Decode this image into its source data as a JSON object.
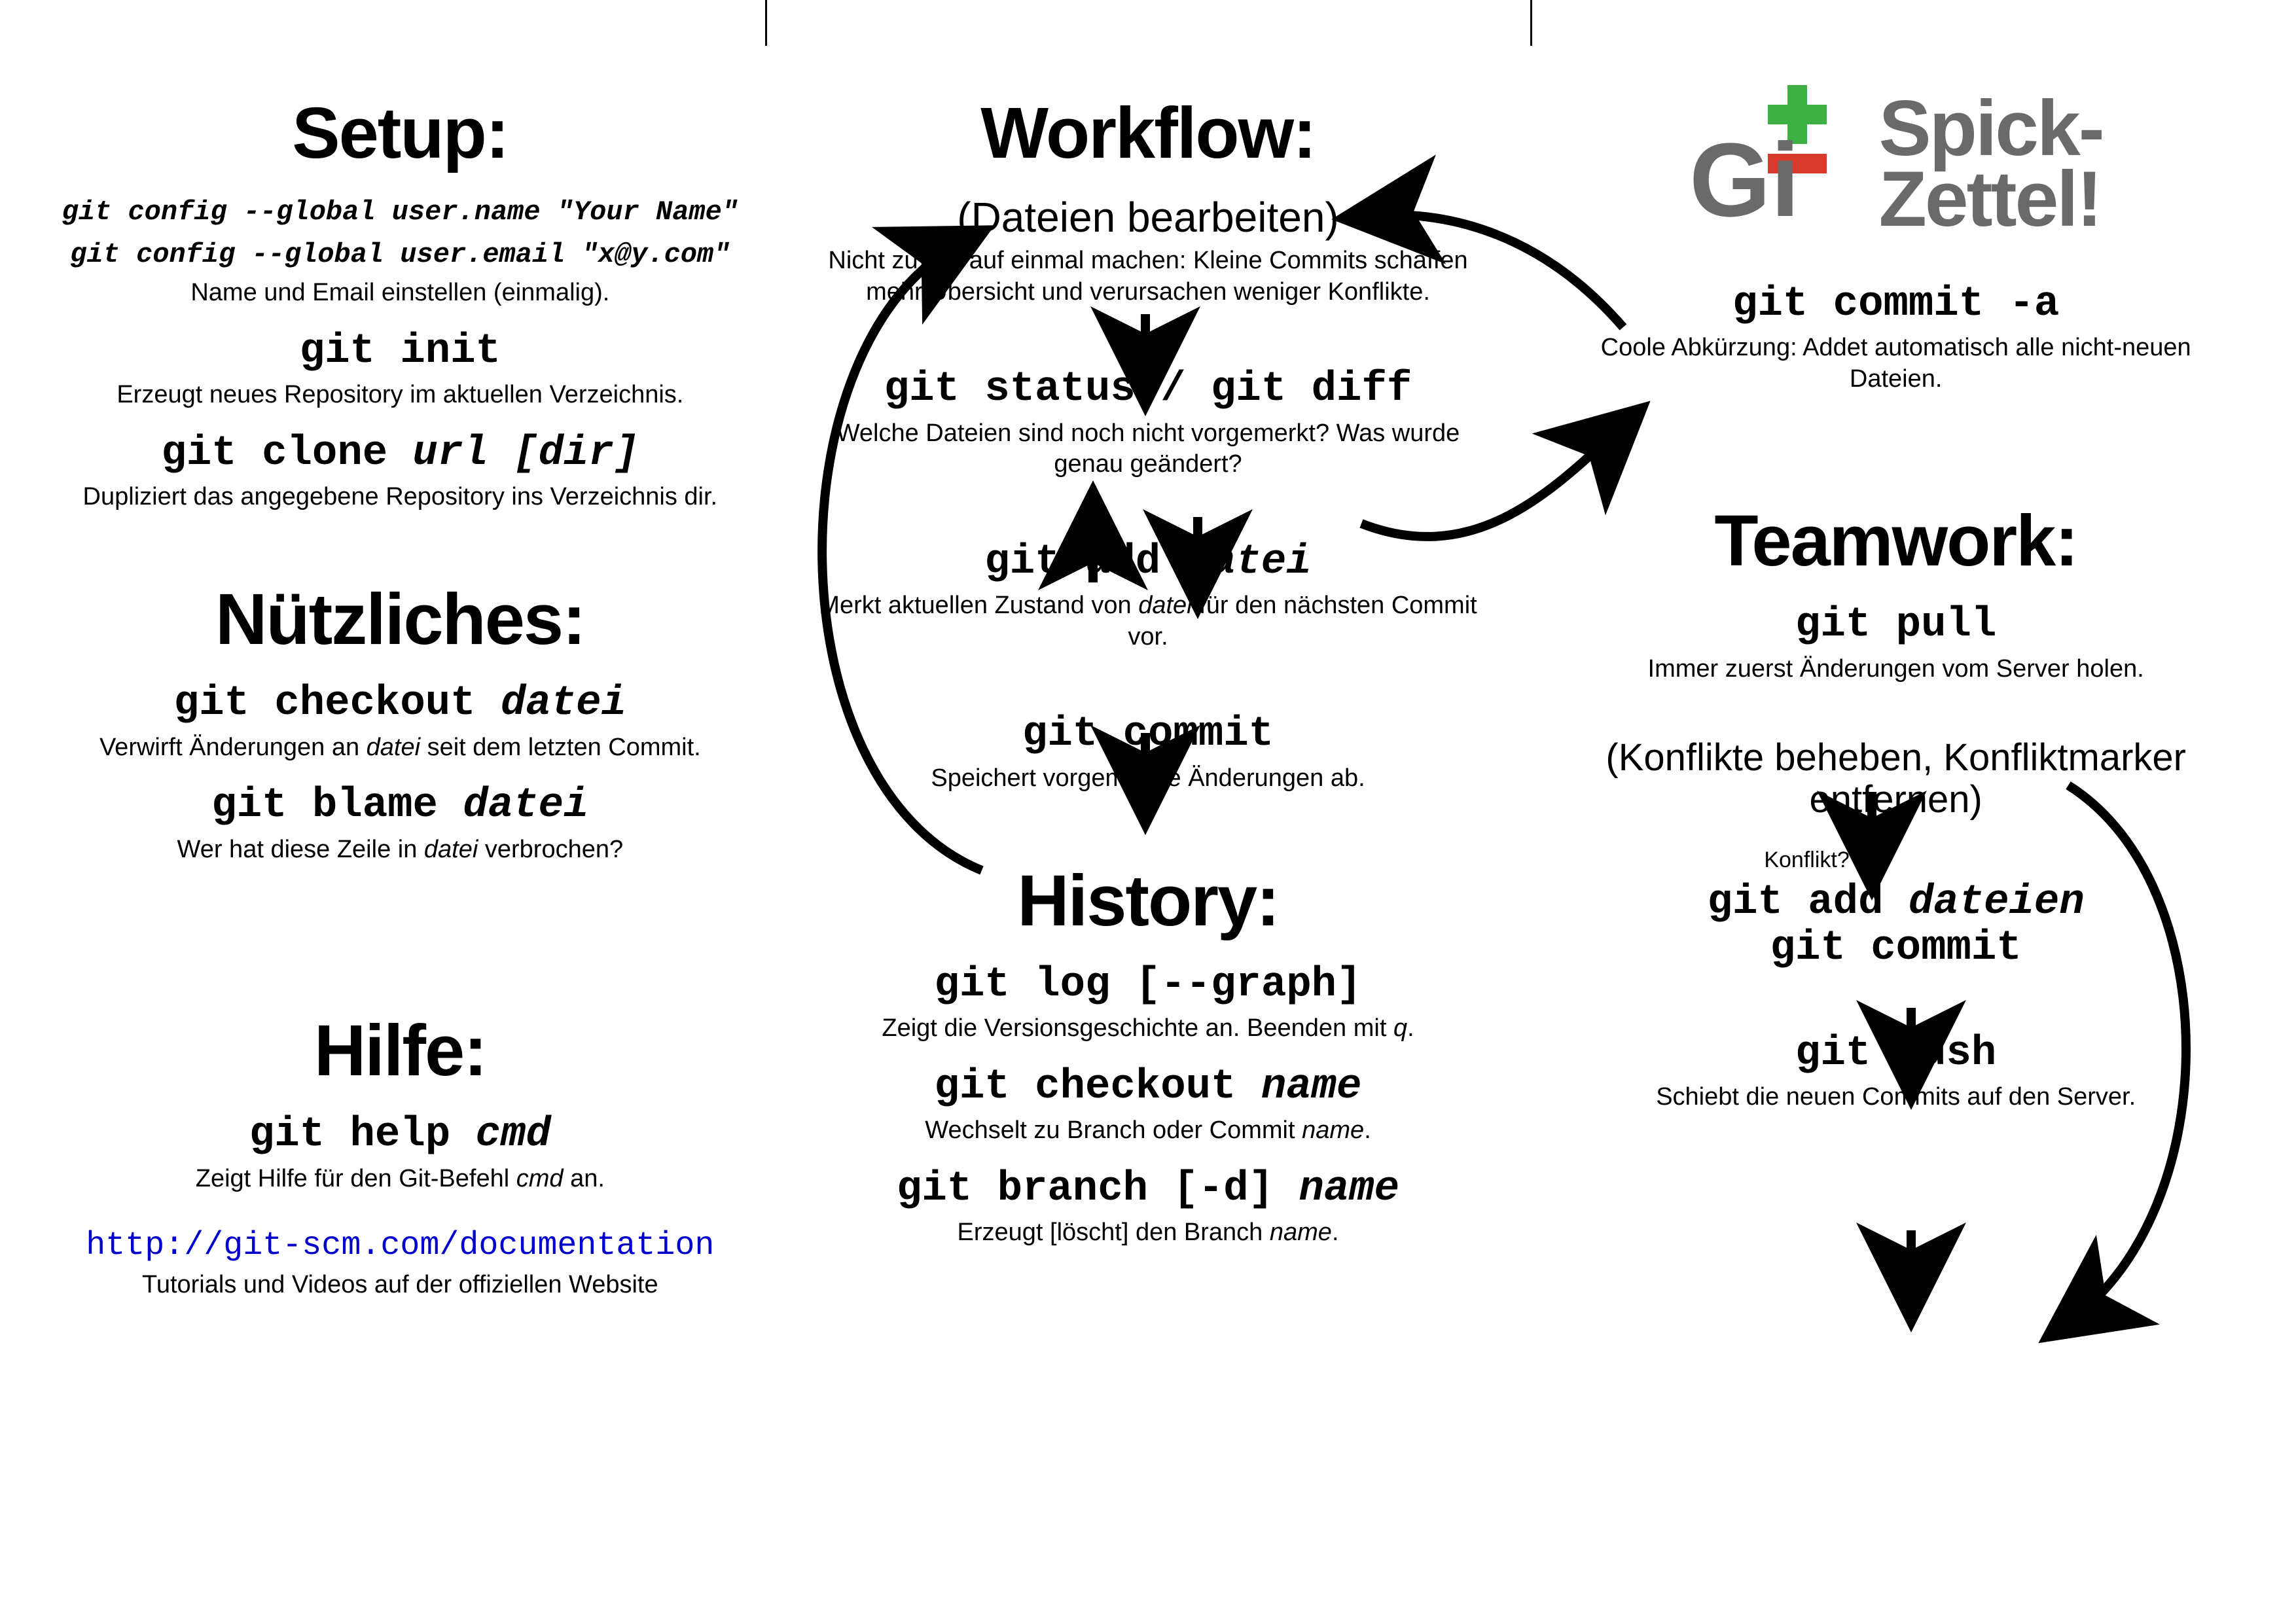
{
  "logo": {
    "line1": "Spick-",
    "line2": "Zettel!"
  },
  "setup": {
    "heading": "Setup:",
    "config_name": "git config --global user.name \"Your Name\"",
    "config_email": "git config --global user.email \"x@y.com\"",
    "config_desc": "Name und Email einstellen (einmalig).",
    "init_cmd": "git init",
    "init_desc": "Erzeugt neues Repository im aktuellen Verzeichnis.",
    "clone_cmd_a": "git clone ",
    "clone_cmd_b": "url [dir]",
    "clone_desc": "Dupliziert das angegebene Repository ins Verzeichnis dir."
  },
  "useful": {
    "heading": "Nützliches:",
    "checkout_a": "git checkout ",
    "checkout_b": "datei",
    "checkout_desc_a": "Verwirft Änderungen an ",
    "checkout_desc_b": "datei",
    "checkout_desc_c": " seit dem letzten Commit.",
    "blame_a": "git blame ",
    "blame_b": "datei",
    "blame_desc_a": "Wer hat diese Zeile in ",
    "blame_desc_b": "datei",
    "blame_desc_c": " verbrochen?"
  },
  "help": {
    "heading": "Hilfe:",
    "help_a": "git help ",
    "help_b": "cmd",
    "help_desc_a": "Zeigt Hilfe für den Git-Befehl ",
    "help_desc_b": "cmd",
    "help_desc_c": " an.",
    "link": "http://git-scm.com/documentation",
    "link_desc": "Tutorials und Videos auf der offiziellen Website"
  },
  "workflow": {
    "heading": "Workflow:",
    "edit": "(Dateien bearbeiten)",
    "edit_desc": "Nicht zu viel auf einmal machen: Kleine Commits schaffen mehr Übersicht und verursachen weniger Konflikte.",
    "status_cmd": "git status / git diff",
    "status_desc": "Welche Dateien sind noch nicht vorgemerkt? Was wurde genau geändert?",
    "add_a": "git add ",
    "add_b": "datei",
    "add_desc_a": "Merkt aktuellen Zustand von ",
    "add_desc_b": "datei",
    "add_desc_c": " für den nächsten Commit vor.",
    "commit_cmd": "git commit",
    "commit_desc": "Speichert vorgemerkte Änderungen ab."
  },
  "history": {
    "heading": "History:",
    "log_cmd": "git log [--graph]",
    "log_desc_a": "Zeigt die Versionsgeschichte an. Beenden mit ",
    "log_desc_b": "q",
    "log_desc_c": ".",
    "checkout_a": "git checkout ",
    "checkout_b": "name",
    "checkout_desc_a": "Wechselt zu Branch oder Commit ",
    "checkout_desc_b": "name",
    "checkout_desc_c": ".",
    "branch_a": "git branch [-d] ",
    "branch_b": "name",
    "branch_desc_a": "Erzeugt [löscht] den Branch ",
    "branch_desc_b": "name",
    "branch_desc_c": "."
  },
  "commit_a": {
    "cmd": "git commit -a",
    "desc": "Coole Abkürzung: Addet automatisch alle nicht-neuen Dateien."
  },
  "teamwork": {
    "heading": "Teamwork:",
    "pull_cmd": "git pull",
    "pull_desc": "Immer zuerst Änderungen vom Server holen.",
    "konflikt_label": "Konflikt?",
    "resolve": "(Konflikte beheben, Konfliktmarker entfernen)",
    "add_a": "git add ",
    "add_b": "dateien",
    "commit_cmd": "git commit",
    "push_cmd": "git push",
    "push_desc": "Schiebt die neuen Commits auf den Server."
  }
}
